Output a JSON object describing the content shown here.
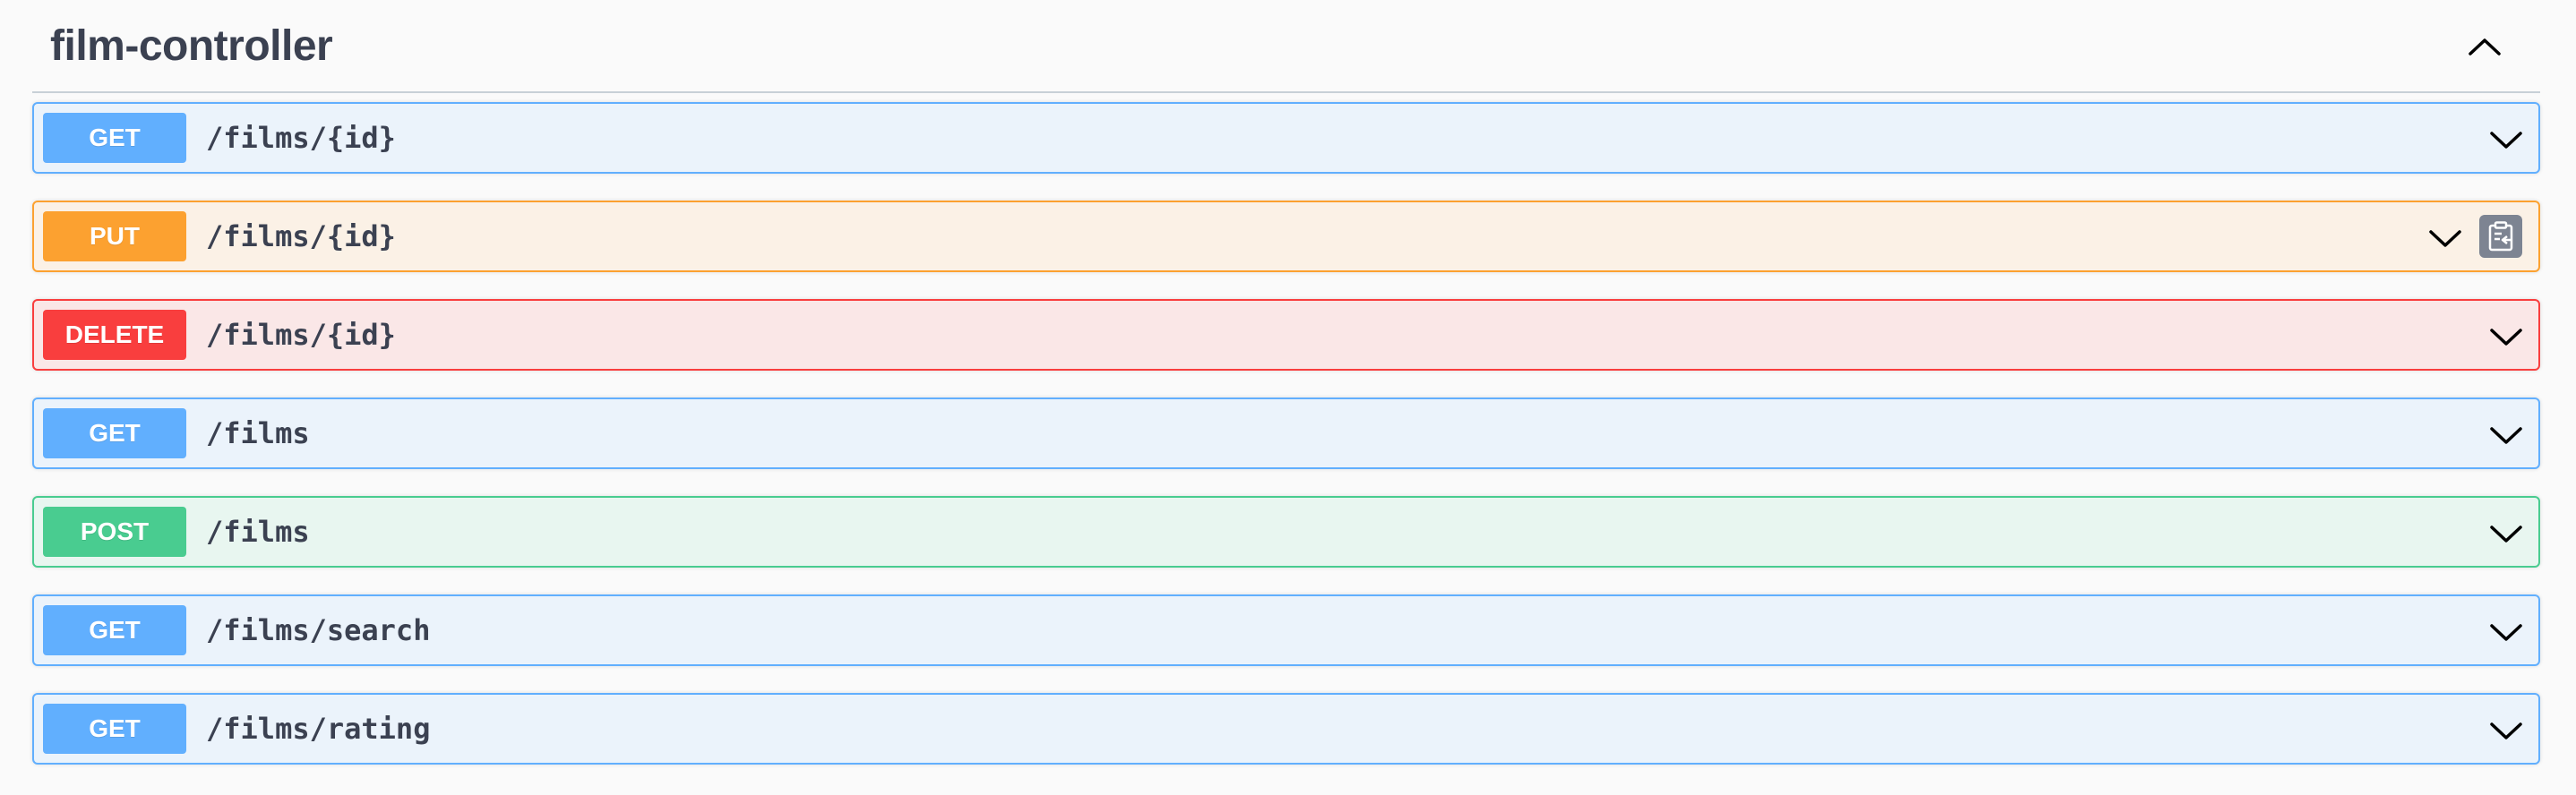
{
  "tag": {
    "title": "film-controller"
  },
  "operations": [
    {
      "method": "GET",
      "path": "/films/{id}"
    },
    {
      "method": "PUT",
      "path": "/films/{id}"
    },
    {
      "method": "DELETE",
      "path": "/films/{id}"
    },
    {
      "method": "GET",
      "path": "/films"
    },
    {
      "method": "POST",
      "path": "/films"
    },
    {
      "method": "GET",
      "path": "/films/search"
    },
    {
      "method": "GET",
      "path": "/films/rating"
    }
  ],
  "icons": {
    "tag_toggle": "chevron-up-icon",
    "op_toggle": "chevron-down-icon",
    "copy": "copy-to-clipboard-icon"
  },
  "colors": {
    "get": "#61affe",
    "put": "#fca130",
    "delete": "#f93e3e",
    "post": "#49cc90",
    "text": "#3b4151"
  }
}
